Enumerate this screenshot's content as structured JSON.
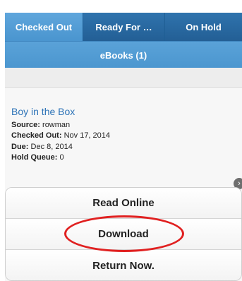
{
  "tabs": [
    {
      "label": "Checked Out",
      "active": true
    },
    {
      "label": "Ready For …",
      "active": false
    },
    {
      "label": "On Hold",
      "active": false
    }
  ],
  "subtab": {
    "label": "eBooks (1)"
  },
  "book": {
    "title": "Boy in the Box",
    "source_label": "Source:",
    "source_value": "rowman",
    "checked_out_label": "Checked Out:",
    "checked_out_value": "Nov 17, 2014",
    "due_label": "Due:",
    "due_value": "Dec 8, 2014",
    "hold_queue_label": "Hold Queue:",
    "hold_queue_value": "0"
  },
  "actions": {
    "read_online": "Read Online",
    "download": "Download",
    "return_now": "Return Now."
  },
  "icons": {
    "more": "chevron-right-icon"
  },
  "colors": {
    "tab_active": "#4a95cf",
    "tab_inactive": "#235f95",
    "subtab_bar": "#4b96cf",
    "title_link": "#2d73b7",
    "highlight": "#e02020"
  }
}
